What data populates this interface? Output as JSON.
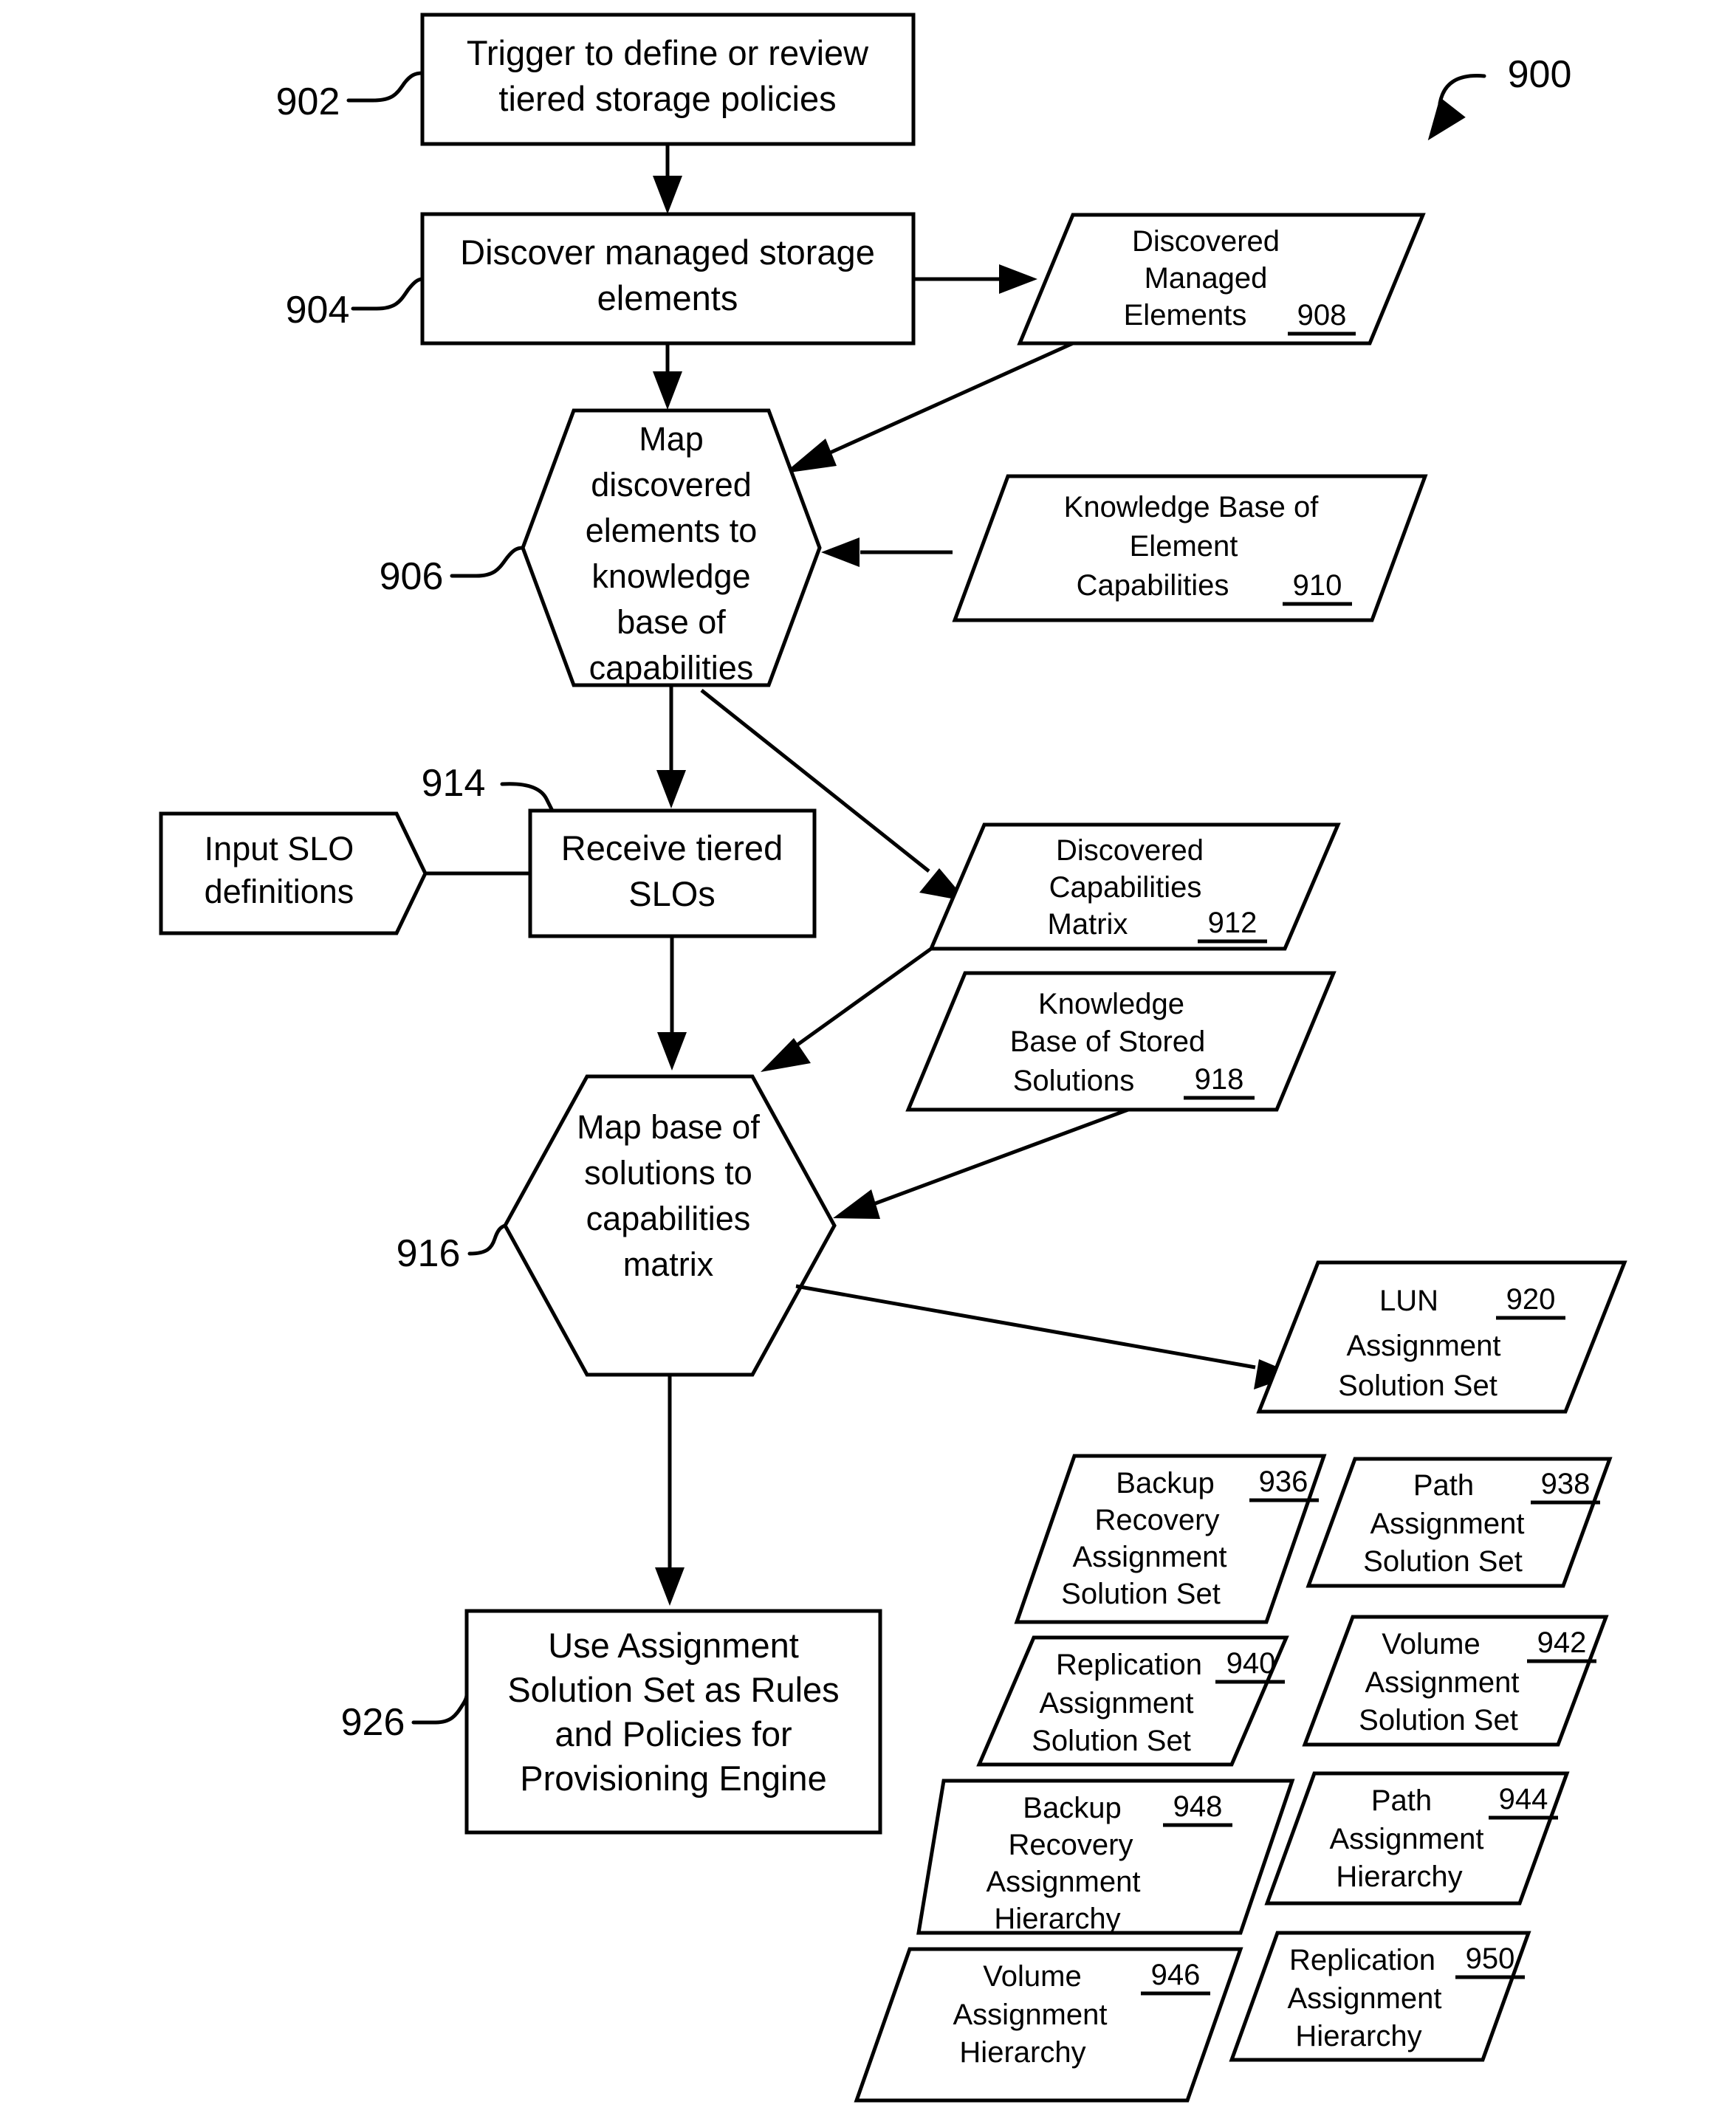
{
  "figure": {
    "number": "900"
  },
  "nodes": {
    "n902": {
      "ref": "902",
      "lines": [
        "Trigger to define or review",
        "tiered storage policies"
      ],
      "shape": "rectangle"
    },
    "n904": {
      "ref": "904",
      "lines": [
        "Discover managed storage",
        "elements"
      ],
      "shape": "rectangle"
    },
    "n906": {
      "ref": "906",
      "lines": [
        "Map",
        "discovered",
        "elements to",
        "knowledge",
        "base of",
        "capabilities"
      ],
      "shape": "hexagon"
    },
    "n908": {
      "ref": "908",
      "lines": [
        "Discovered",
        "Managed",
        "Elements"
      ],
      "shape": "parallelogram"
    },
    "n910": {
      "ref": "910",
      "lines": [
        "Knowledge Base of",
        "Element",
        "Capabilities"
      ],
      "shape": "parallelogram"
    },
    "n912": {
      "ref": "912",
      "lines": [
        "Discovered",
        "Capabilities",
        "Matrix"
      ],
      "shape": "parallelogram"
    },
    "n914": {
      "ref": "914",
      "lines": [
        "Receive tiered",
        "SLOs"
      ],
      "shape": "rectangle"
    },
    "ninput": {
      "ref": "",
      "lines": [
        "Input SLO",
        "definitions"
      ],
      "shape": "flag"
    },
    "n916": {
      "ref": "916",
      "lines": [
        "Map base of",
        "solutions to",
        "capabilities",
        "matrix"
      ],
      "shape": "hexagon"
    },
    "n918": {
      "ref": "918",
      "lines": [
        "Knowledge",
        "Base of Stored",
        "Solutions"
      ],
      "shape": "parallelogram"
    },
    "n920": {
      "ref": "920",
      "lines": [
        "LUN",
        "Assignment",
        "Solution Set"
      ],
      "shape": "parallelogram"
    },
    "n926": {
      "ref": "926",
      "lines": [
        "Use Assignment",
        "Solution Set as Rules",
        "and Policies for",
        "Provisioning Engine"
      ],
      "shape": "rectangle"
    },
    "n936": {
      "ref": "936",
      "lines": [
        "Backup",
        "Recovery",
        "Assignment",
        "Solution Set"
      ],
      "shape": "parallelogram"
    },
    "n938": {
      "ref": "938",
      "lines": [
        "Path",
        "Assignment",
        "Solution Set"
      ],
      "shape": "parallelogram"
    },
    "n940": {
      "ref": "940",
      "lines": [
        "Replication",
        "Assignment",
        "Solution Set"
      ],
      "shape": "parallelogram"
    },
    "n942": {
      "ref": "942",
      "lines": [
        "Volume",
        "Assignment",
        "Solution Set"
      ],
      "shape": "parallelogram"
    },
    "n948": {
      "ref": "948",
      "lines": [
        "Backup",
        "Recovery",
        "Assignment",
        "Hierarchy"
      ],
      "shape": "parallelogram"
    },
    "n944": {
      "ref": "944",
      "lines": [
        "Path",
        "Assignment",
        "Hierarchy"
      ],
      "shape": "parallelogram"
    },
    "n946": {
      "ref": "946",
      "lines": [
        "Volume",
        "Assignment",
        "Hierarchy"
      ],
      "shape": "parallelogram"
    },
    "n950": {
      "ref": "950",
      "lines": [
        "Replication",
        "Assignment",
        "Hierarchy"
      ],
      "shape": "parallelogram"
    }
  }
}
